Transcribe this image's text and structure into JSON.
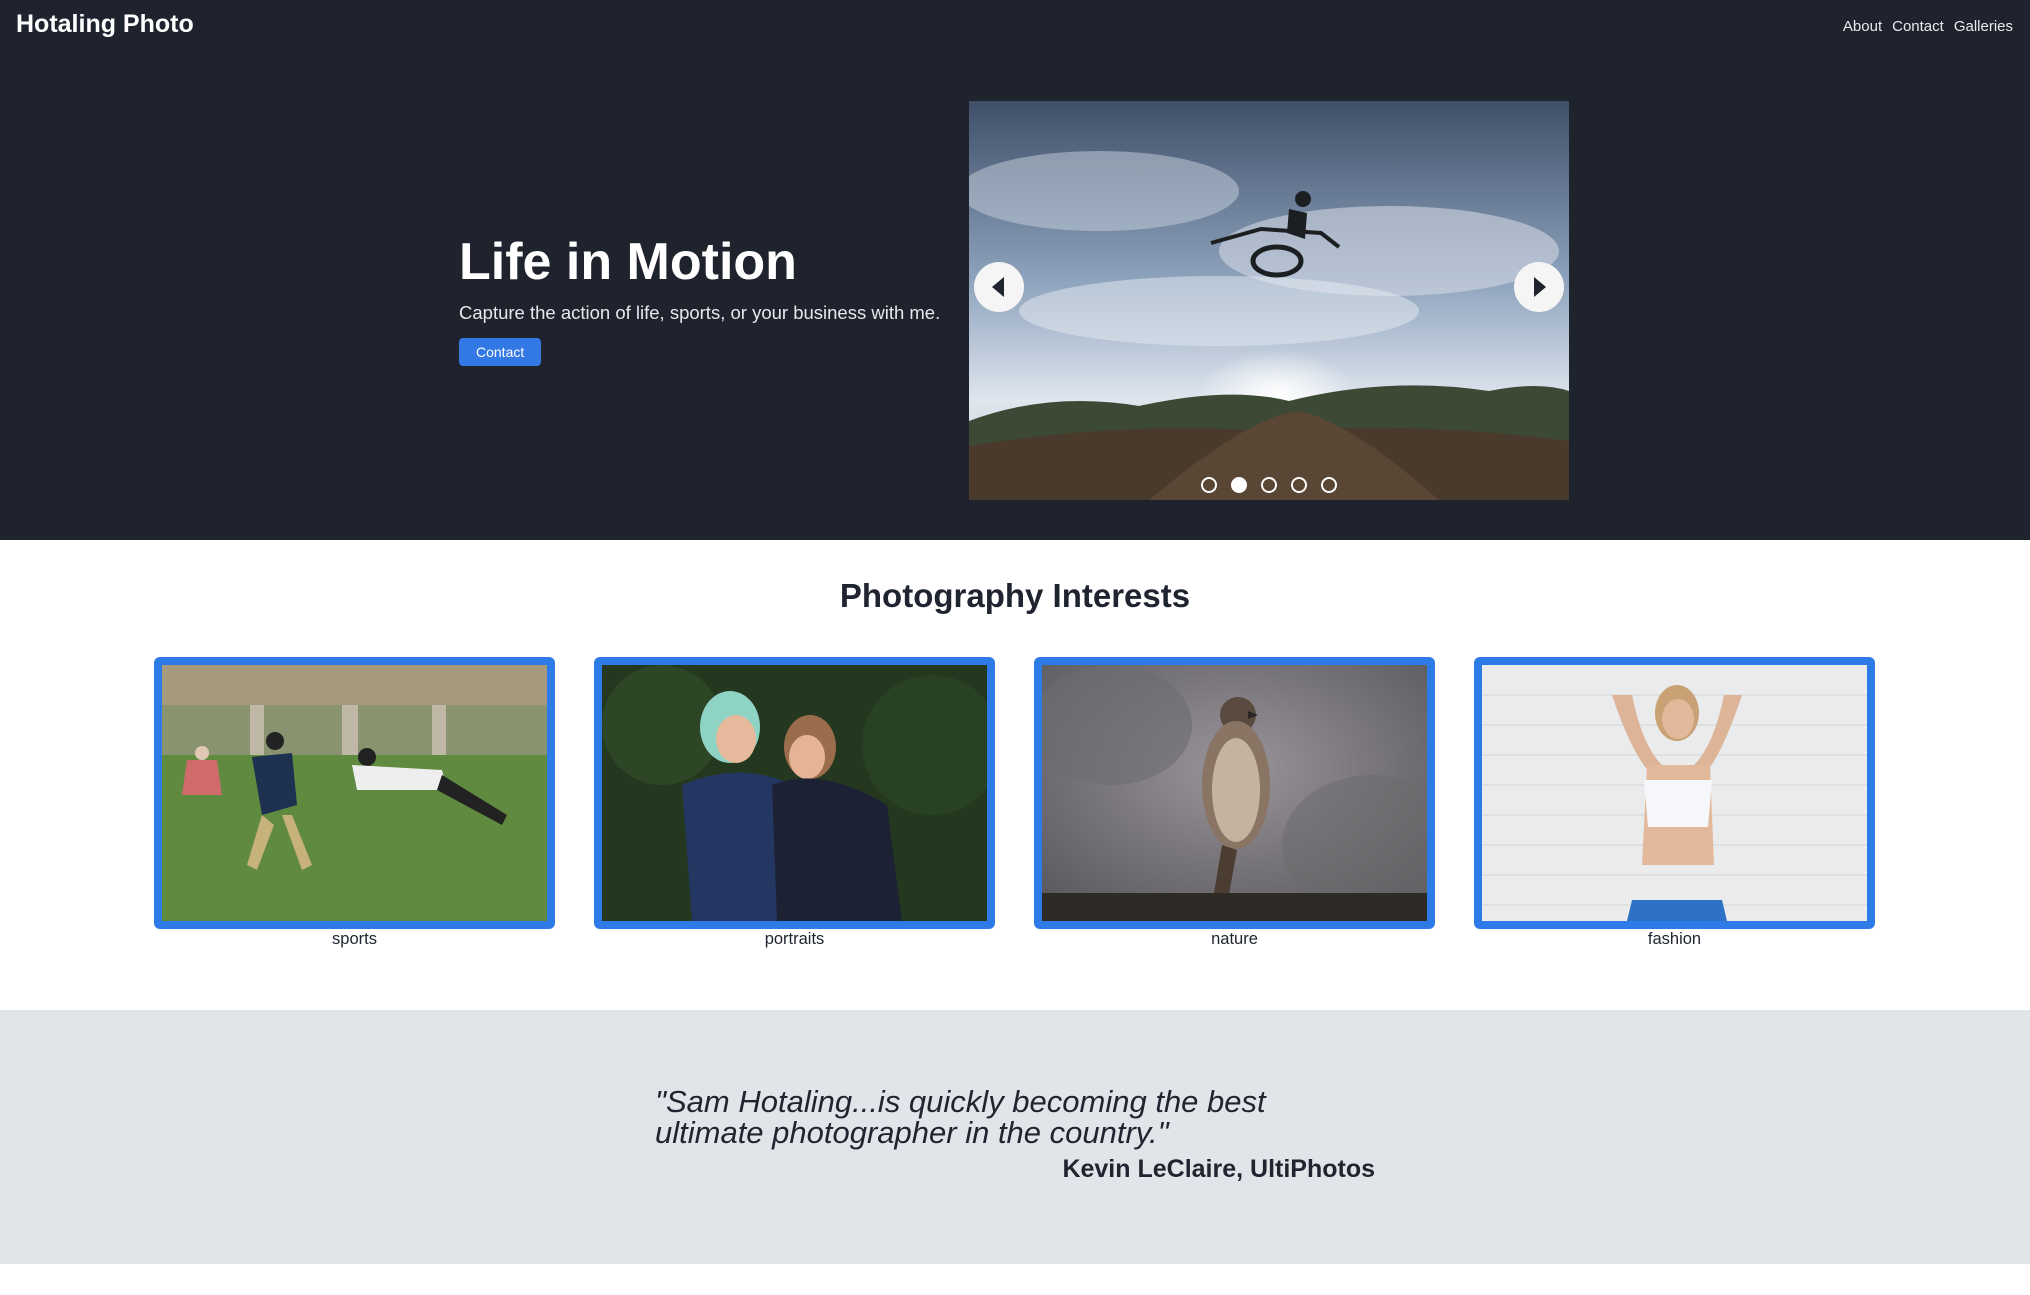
{
  "header": {
    "brand": "Hotaling Photo",
    "nav": [
      "About",
      "Contact",
      "Galleries"
    ]
  },
  "hero": {
    "title": "Life in Motion",
    "subtitle": "Capture the action of life, sports, or your business with me.",
    "button_label": "Contact"
  },
  "carousel": {
    "slide_count": 5,
    "active_index": 1,
    "prev_icon": "chevron-left-icon",
    "next_icon": "chevron-right-icon"
  },
  "interests": {
    "title": "Photography Interests",
    "items": [
      {
        "label": "sports"
      },
      {
        "label": "portraits"
      },
      {
        "label": "nature"
      },
      {
        "label": "fashion"
      }
    ]
  },
  "testimonial": {
    "quote": "\"Sam Hotaling...is quickly becoming the best ultimate photographer in the country.\"",
    "author": "Kevin LeClaire, UltiPhotos"
  },
  "colors": {
    "header_bg": "#1e232d",
    "accent": "#2e7be8",
    "quote_bg": "#e1e4e8"
  }
}
